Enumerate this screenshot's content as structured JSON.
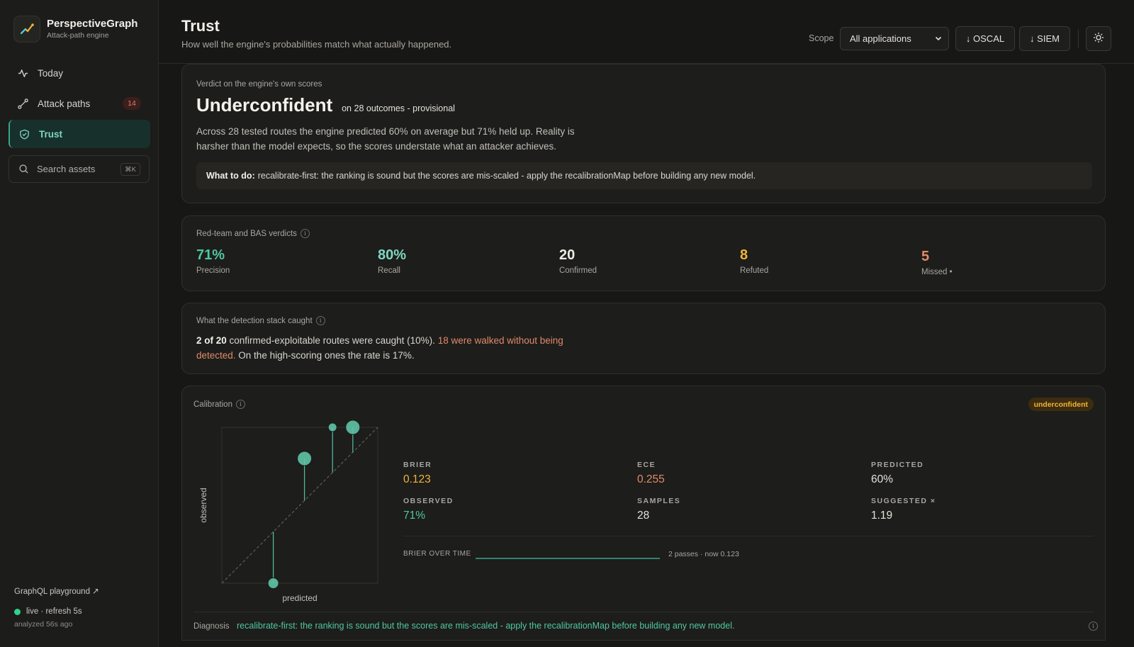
{
  "brand": {
    "name": "PerspectiveGraph",
    "subtitle": "Attack-path engine"
  },
  "nav": [
    {
      "label": "Today",
      "icon": "activity-icon"
    },
    {
      "label": "Attack paths",
      "icon": "route-icon",
      "badge": "14"
    },
    {
      "label": "Trust",
      "icon": "shield-icon",
      "active": true
    }
  ],
  "search": {
    "placeholder": "Search assets",
    "shortcut": "⌘K"
  },
  "footer": {
    "playground": "GraphQL playground ↗",
    "live": "live · refresh 5s",
    "analyzed": "analyzed 56s ago"
  },
  "header": {
    "title": "Trust",
    "subtitle": "How well the engine's probabilities match what actually happened.",
    "scope_label": "Scope",
    "scope_value": "All applications",
    "oscal_label": "↓ OSCAL",
    "siem_label": "↓ SIEM"
  },
  "verdict": {
    "label": "Verdict on the engine's own scores",
    "title": "Underconfident",
    "qualifier": "on 28 outcomes - provisional",
    "body_line1": "Across 28 tested routes the engine predicted 60% on average but 71% held up. Reality is",
    "body_line2": "harsher than the model expects, so the scores understate what an attacker achieves.",
    "todo_label": "What to do:",
    "todo_text": "recalibrate-first: the ranking is sound but the scores are mis-scaled - apply the recalibrationMap before building any new model."
  },
  "redteam": {
    "label": "Red-team and BAS verdicts",
    "stats": [
      {
        "value": "71%",
        "label": "Precision",
        "color": "#4fc7a3"
      },
      {
        "value": "80%",
        "label": "Recall",
        "color": "#7fd6c0"
      },
      {
        "value": "20",
        "label": "Confirmed",
        "color": "#ecebe6"
      },
      {
        "value": "8",
        "label": "Refuted",
        "color": "#f0b43a"
      },
      {
        "value": "5",
        "label": "Missed •",
        "color": "#e08a6a"
      }
    ]
  },
  "detection": {
    "label": "What the detection stack caught",
    "strong": "2 of 20",
    "text1": " confirmed-exploitable routes were caught (10%). ",
    "alert_line1": "18 were walked without being",
    "alert_line2": "detected.",
    "text2": " On the high-scoring ones the rate is 17%."
  },
  "calibration": {
    "label": "Calibration",
    "badge": "underconfident",
    "metrics": [
      {
        "label": "BRIER",
        "value": "0.123",
        "color": "#f0b43a"
      },
      {
        "label": "ECE",
        "value": "0.255",
        "color": "#e08a6a"
      },
      {
        "label": "PREDICTED",
        "value": "60%",
        "color": "#e4e1da"
      },
      {
        "label": "OBSERVED",
        "value": "71%",
        "color": "#4fc7a3"
      },
      {
        "label": "SAMPLES",
        "value": "28",
        "color": "#e4e1da"
      },
      {
        "label": "SUGGESTED ×",
        "value": "1.19",
        "color": "#e4e1da"
      }
    ],
    "brier_over_time_label": "BRIER OVER TIME",
    "brier_over_time_note": "2 passes · now 0.123",
    "diagnosis_label": "Diagnosis",
    "diagnosis_text": "recalibrate-first: the ranking is sound but the scores are mis-scaled - apply the recalibrationMap before building any new model."
  },
  "chart_data": {
    "type": "scatter",
    "xlabel": "predicted",
    "ylabel": "observed",
    "xlim": [
      0,
      1
    ],
    "ylim": [
      0,
      1
    ],
    "points": [
      {
        "x": 0.33,
        "y": 0.0,
        "size": "medium"
      },
      {
        "x": 0.53,
        "y": 0.8,
        "size": "large"
      },
      {
        "x": 0.71,
        "y": 1.0,
        "size": "small"
      },
      {
        "x": 0.84,
        "y": 1.0,
        "size": "large"
      }
    ],
    "reference_line": "diagonal"
  },
  "colors": {
    "accent": "#3aa58c",
    "warning": "#f0b43a",
    "danger": "#e08a6a"
  }
}
